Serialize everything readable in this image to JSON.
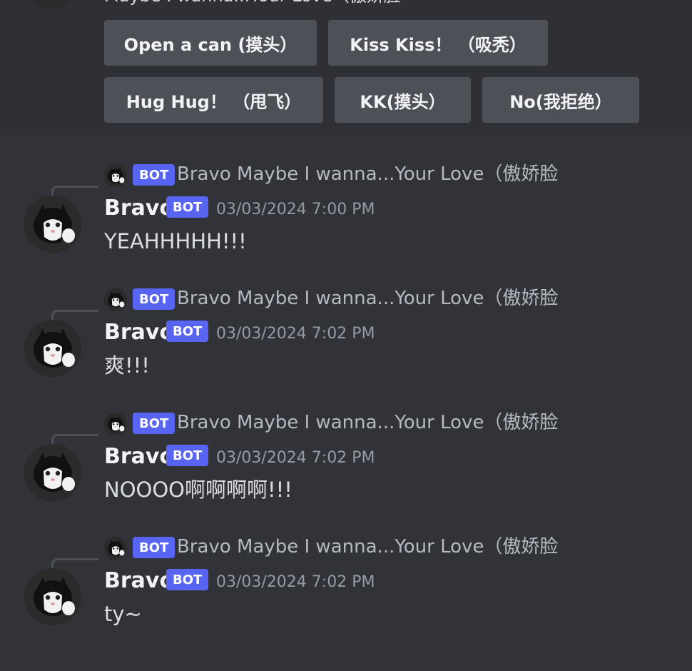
{
  "top": {
    "text": "Maybe I wanna...Your Love（傲娇脸",
    "buttons_row1": [
      "Open a can (摸头）",
      "Kiss Kiss！ （吸秃）"
    ],
    "buttons_row2": [
      "Hug Hug！ （甩飞）",
      "KK(摸头）",
      "No(我拒绝）"
    ]
  },
  "avatar_label": "Bravo!",
  "messages": [
    {
      "reply_author": "Bravo",
      "reply_tag": "BOT",
      "reply_text": "Bravo Maybe I wanna...Your Love（傲娇脸",
      "author": "Bravo",
      "tag": "BOT",
      "timestamp": "03/03/2024 7:00 PM",
      "content": "YEAHHHHH!!!"
    },
    {
      "reply_author": "Bravo",
      "reply_tag": "BOT",
      "reply_text": "Bravo Maybe I wanna...Your Love（傲娇脸",
      "author": "Bravo",
      "tag": "BOT",
      "timestamp": "03/03/2024 7:02 PM",
      "content": "爽!!!"
    },
    {
      "reply_author": "Bravo",
      "reply_tag": "BOT",
      "reply_text": "Bravo Maybe I wanna...Your Love（傲娇脸",
      "author": "Bravo",
      "tag": "BOT",
      "timestamp": "03/03/2024 7:02 PM",
      "content": "NOOOO啊啊啊啊!!!"
    },
    {
      "reply_author": "Bravo",
      "reply_tag": "BOT",
      "reply_text": "Bravo Maybe I wanna...Your Love（傲娇脸",
      "author": "Bravo",
      "tag": "BOT",
      "timestamp": "03/03/2024 7:02 PM",
      "content": "ty~"
    }
  ],
  "colors": {
    "background": "#313338",
    "top_block": "#2e3035",
    "button": "#4e5058",
    "bot_tag": "#5865f2",
    "timestamp": "#949ba4"
  }
}
